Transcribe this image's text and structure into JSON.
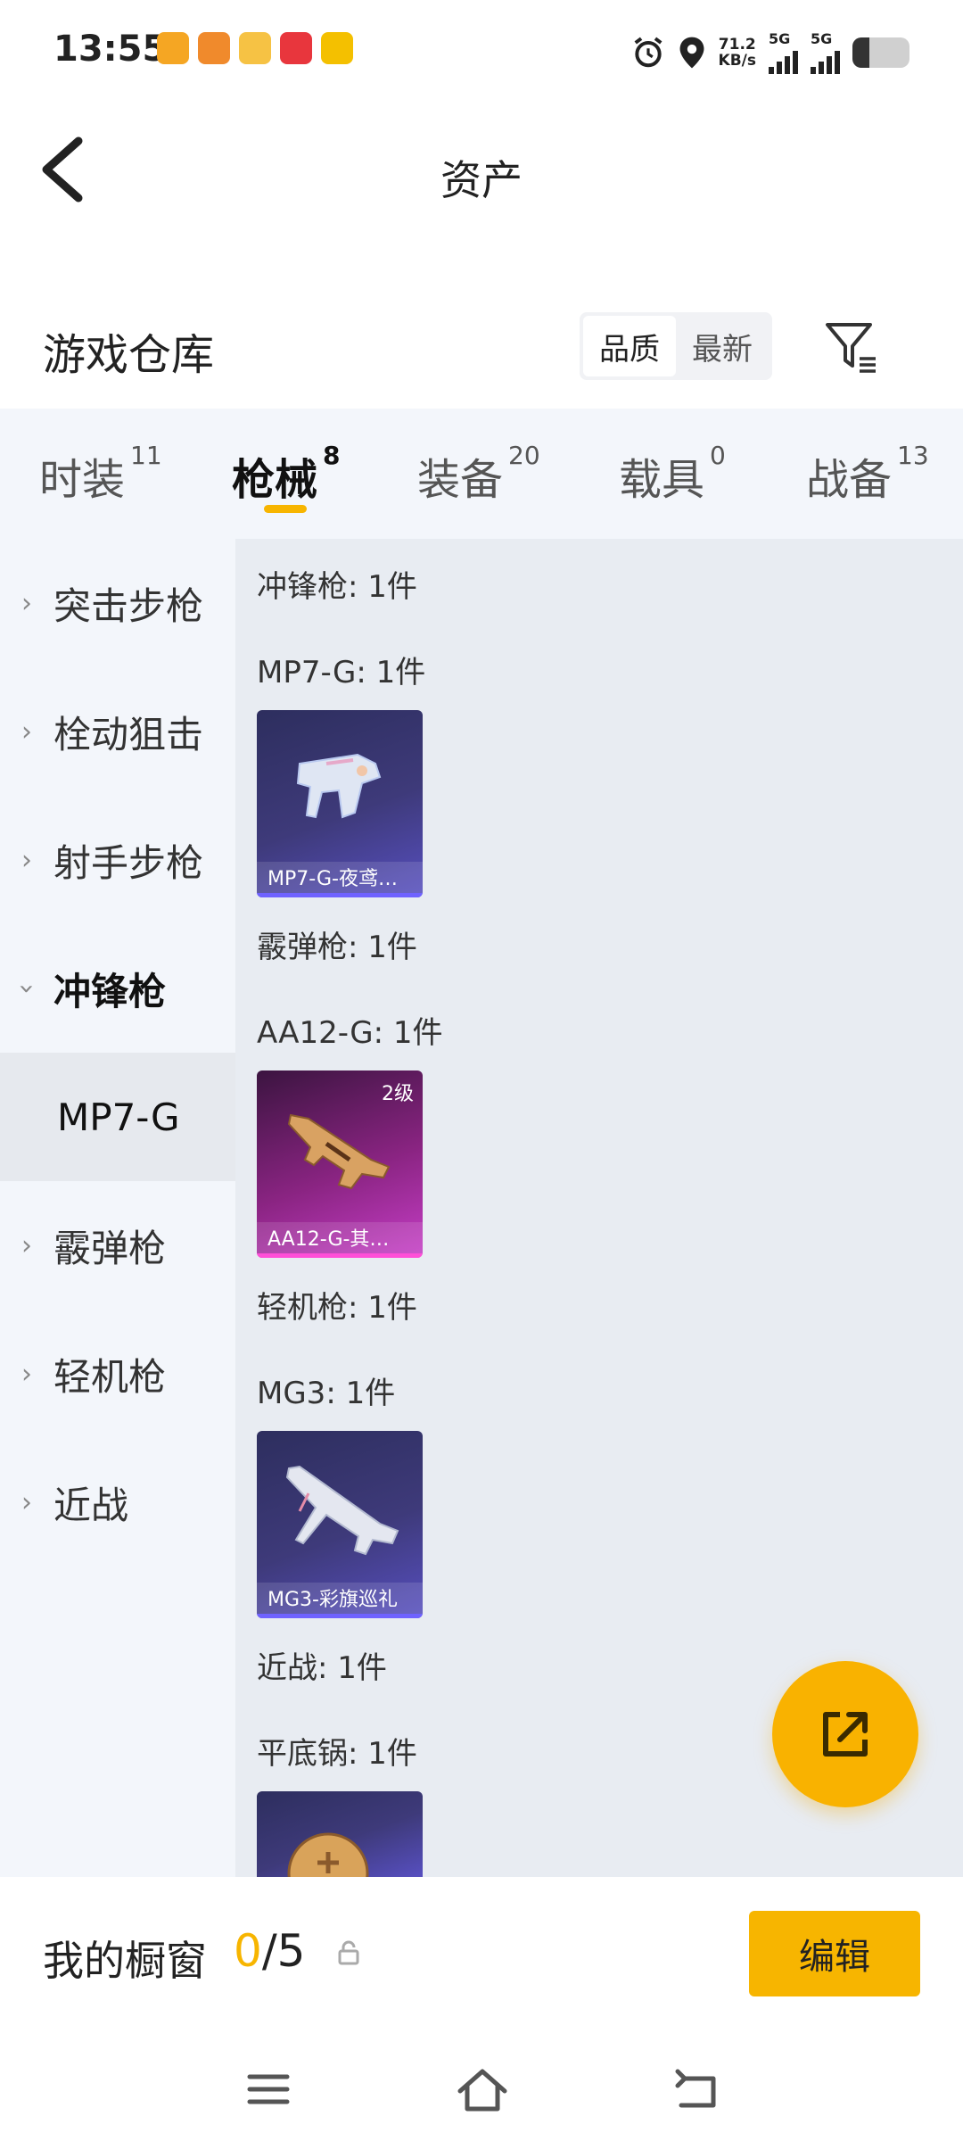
{
  "status_bar": {
    "time": "13:55",
    "speed_value": "71.2",
    "speed_unit": "KB/s",
    "net1": "5G",
    "net2": "5G",
    "battery_level": 0.3,
    "icons": [
      "alarm-icon",
      "location-icon"
    ]
  },
  "header": {
    "title": "资产",
    "back_icon": "chevron-left-icon"
  },
  "warehouse": {
    "title": "游戏仓库",
    "sort_options": [
      "品质",
      "最新"
    ],
    "active_sort": "品质",
    "filter_icon": "filter-icon"
  },
  "tabs": [
    {
      "label": "时装",
      "count": "11"
    },
    {
      "label": "枪械",
      "count": "8",
      "active": true
    },
    {
      "label": "装备",
      "count": "20"
    },
    {
      "label": "载具",
      "count": "0"
    },
    {
      "label": "战备",
      "count": "13"
    }
  ],
  "sidebar": {
    "items": [
      {
        "label": "突击步枪"
      },
      {
        "label": "栓动狙击"
      },
      {
        "label": "射手步枪"
      },
      {
        "label": "冲锋枪",
        "expanded": true
      },
      {
        "label": "MP7-G",
        "selected": true
      },
      {
        "label": "霰弹枪"
      },
      {
        "label": "轻机枪"
      },
      {
        "label": "近战"
      }
    ]
  },
  "content": {
    "groups": [
      {
        "category": "冲锋枪: 1件",
        "sub": "MP7-G: 1件",
        "card_name": "MP7-G-夜鸢…",
        "color": "purple",
        "level": ""
      },
      {
        "category": "霰弹枪: 1件",
        "sub": "AA12-G: 1件",
        "card_name": "AA12-G-其…",
        "color": "pink",
        "level": "2级"
      },
      {
        "category": "轻机枪: 1件",
        "sub": "MG3: 1件",
        "card_name": "MG3-彩旗巡礼",
        "color": "purple",
        "level": ""
      },
      {
        "category": "近战: 1件",
        "sub": "平底锅: 1件",
        "card_name": "",
        "color": "purple",
        "level": ""
      }
    ]
  },
  "fab": {
    "icon": "share-icon"
  },
  "bottom": {
    "label": "我的橱窗",
    "current": "0",
    "total": "/5",
    "lock_icon": "lock-icon",
    "edit_label": "编辑"
  },
  "navbar": {
    "icons": [
      "menu-icon",
      "home-icon",
      "back-icon"
    ]
  },
  "colors": {
    "accent": "#f7b500",
    "sidebar_bg": "#f3f6fb",
    "content_bg": "#e8ecf2"
  }
}
